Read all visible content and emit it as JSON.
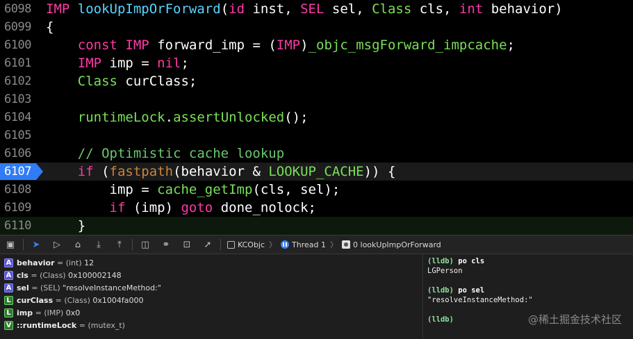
{
  "editor": {
    "lines": [
      {
        "num": "6098",
        "tokens": [
          {
            "t": "IMP",
            "c": "ty"
          },
          {
            "t": " "
          },
          {
            "t": "lookUpImpOrForward",
            "c": "fn"
          },
          {
            "t": "("
          },
          {
            "t": "id",
            "c": "ty"
          },
          {
            "t": " inst, "
          },
          {
            "t": "SEL",
            "c": "ty"
          },
          {
            "t": " sel, "
          },
          {
            "t": "Class",
            "c": "call"
          },
          {
            "t": " cls, "
          },
          {
            "t": "int",
            "c": "ty"
          },
          {
            "t": " behavior)"
          }
        ]
      },
      {
        "num": "6099",
        "tokens": [
          {
            "t": "{"
          }
        ]
      },
      {
        "num": "6100",
        "tokens": [
          {
            "t": "    "
          },
          {
            "t": "const",
            "c": "kw"
          },
          {
            "t": " "
          },
          {
            "t": "IMP",
            "c": "ty"
          },
          {
            "t": " forward_imp = ("
          },
          {
            "t": "IMP",
            "c": "ty"
          },
          {
            "t": ")"
          },
          {
            "t": "_objc_msgForward_impcache",
            "c": "call"
          },
          {
            "t": ";"
          }
        ]
      },
      {
        "num": "6101",
        "tokens": [
          {
            "t": "    "
          },
          {
            "t": "IMP",
            "c": "ty"
          },
          {
            "t": " imp = "
          },
          {
            "t": "nil",
            "c": "kw"
          },
          {
            "t": ";"
          }
        ]
      },
      {
        "num": "6102",
        "tokens": [
          {
            "t": "    "
          },
          {
            "t": "Class",
            "c": "call"
          },
          {
            "t": " curClass;"
          }
        ]
      },
      {
        "num": "6103",
        "tokens": []
      },
      {
        "num": "6104",
        "tokens": [
          {
            "t": "    "
          },
          {
            "t": "runtimeLock",
            "c": "call"
          },
          {
            "t": "."
          },
          {
            "t": "assertUnlocked",
            "c": "call"
          },
          {
            "t": "();"
          }
        ]
      },
      {
        "num": "6105",
        "tokens": []
      },
      {
        "num": "6106",
        "tokens": [
          {
            "t": "    "
          },
          {
            "t": "// Optimistic cache lookup",
            "c": "cm"
          }
        ]
      },
      {
        "num": "6107",
        "current": true,
        "tokens": [
          {
            "t": "    "
          },
          {
            "t": "if",
            "c": "kw"
          },
          {
            "t": " ("
          },
          {
            "t": "fastpath",
            "c": "mac"
          },
          {
            "t": "(behavior & "
          },
          {
            "t": "LOOKUP_CACHE",
            "c": "call"
          },
          {
            "t": ")) {"
          }
        ]
      },
      {
        "num": "6108",
        "tokens": [
          {
            "t": "        imp = "
          },
          {
            "t": "cache_getImp",
            "c": "call"
          },
          {
            "t": "(cls, sel);"
          }
        ]
      },
      {
        "num": "6109",
        "tokens": [
          {
            "t": "        "
          },
          {
            "t": "if",
            "c": "kw"
          },
          {
            "t": " (imp) "
          },
          {
            "t": "goto",
            "c": "kw"
          },
          {
            "t": " done_nolock;"
          }
        ]
      },
      {
        "num": "6110",
        "last": true,
        "tokens": [
          {
            "t": "    }"
          }
        ]
      }
    ]
  },
  "debugbar": {
    "buttons": [
      {
        "name": "toggle-debug-area-icon",
        "glyph": "▣"
      },
      {
        "name": "breakpoints-active-icon",
        "glyph": "➤",
        "blue": true
      },
      {
        "name": "continue-icon",
        "glyph": "▷"
      },
      {
        "name": "step-over-icon",
        "glyph": "⌂"
      },
      {
        "name": "step-into-icon",
        "glyph": "⤓"
      },
      {
        "name": "step-out-icon",
        "glyph": "⤒"
      },
      {
        "name": "view-hierarchy-icon",
        "glyph": "◫"
      },
      {
        "name": "memory-graph-icon",
        "glyph": "⚭"
      },
      {
        "name": "environment-overrides-icon",
        "glyph": "⊡"
      },
      {
        "name": "simulate-location-icon",
        "glyph": "➚"
      }
    ],
    "target": "KCObjc",
    "thread": "Thread 1",
    "frame": "0 lookUpImpOrForward"
  },
  "variables": [
    {
      "badge": "A",
      "name": "behavior",
      "type": "(int)",
      "value": "12"
    },
    {
      "badge": "A",
      "name": "cls",
      "type": "(Class)",
      "value": "0x100002148"
    },
    {
      "badge": "A",
      "name": "sel",
      "type": "(SEL)",
      "value": "\"resolveInstanceMethod:\""
    },
    {
      "badge": "L",
      "name": "curClass",
      "type": "(Class)",
      "value": "0x1004fa000"
    },
    {
      "badge": "L",
      "name": "imp",
      "type": "(IMP)",
      "value": "0x0"
    },
    {
      "badge": "V",
      "name": "::runtimeLock",
      "type": "(mutex_t)",
      "value": ""
    }
  ],
  "console": {
    "lines": [
      {
        "prompt": "(lldb)",
        "cmd": "po cls"
      },
      {
        "text": "LGPerson"
      },
      {
        "text": ""
      },
      {
        "prompt": "(lldb)",
        "cmd": "po sel"
      },
      {
        "text": "\"resolveInstanceMethod:\""
      },
      {
        "text": ""
      },
      {
        "prompt": "(lldb)",
        "cmd": ""
      }
    ]
  },
  "watermark": "@稀土掘金技术社区"
}
